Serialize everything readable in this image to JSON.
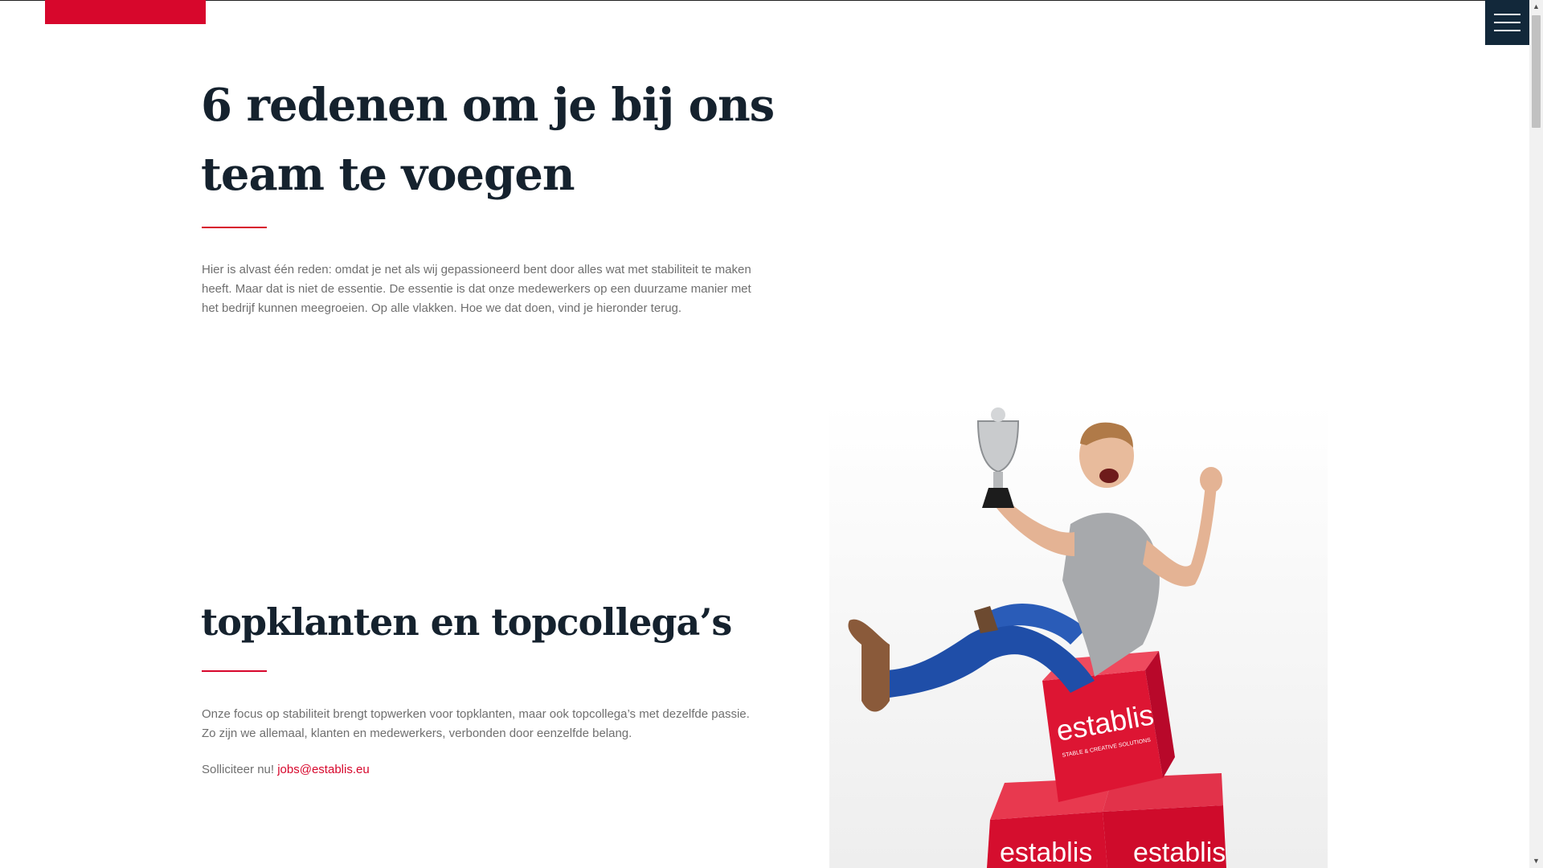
{
  "hero": {
    "title": "6 redenen om je bij ons team te voegen",
    "intro": "Hier is alvast één reden: omdat je net als wij gepassioneerd bent door alles wat met stabiliteit te maken heeft. Maar dat is niet de essentie. De essentie is dat onze medewerkers op een duurzame manier met het bedrijf kunnen meegroeien. Op alle vlakken. Hoe we dat doen, vind je hieronder terug."
  },
  "section": {
    "title": "topklanten en topcollega’s",
    "text": "Onze focus op stabiliteit brengt topwerken voor topklanten, maar ook topcollega’s met dezelfde passie. Zo zijn we allemaal, klanten en medewerkers, verbonden door eenzelfde belang.",
    "apply_prefix": "Solliciteer nu!",
    "apply_email": "jobs@establis.eu"
  },
  "photo": {
    "cube_brand": "establis",
    "cube_tagline": "STABLE & CREATIVE SOLUTIONS"
  },
  "icons": {
    "menu": "hamburger-menu-icon",
    "scroll_up": "scroll-up-arrow-icon",
    "scroll_down": "scroll-down-arrow-icon"
  },
  "colors": {
    "accent": "#d7072c",
    "navy": "#12283a",
    "heading": "#15222e",
    "body_text": "#6f6f6f"
  }
}
